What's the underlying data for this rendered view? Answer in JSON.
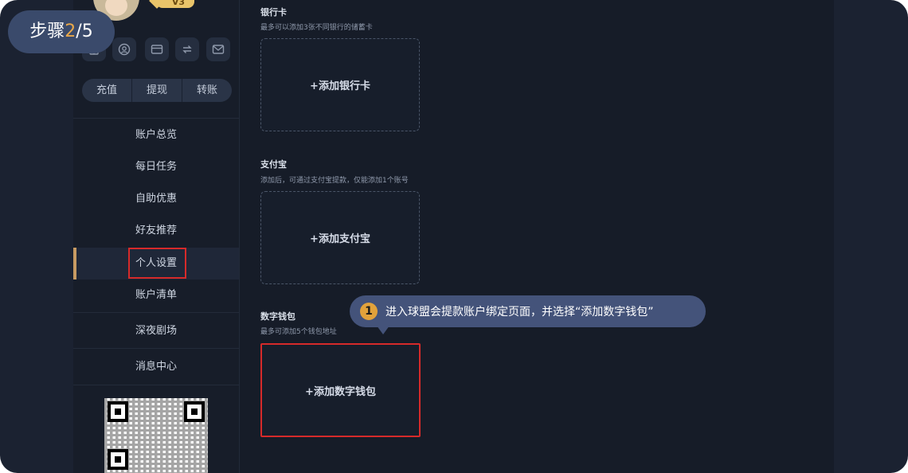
{
  "step": {
    "label": "步骤",
    "current": "2",
    "separator": "/",
    "total": "5"
  },
  "profile": {
    "vip_level": "V3"
  },
  "quick_actions": [
    "充值",
    "提现",
    "转账"
  ],
  "menu": [
    {
      "label": "账户总览"
    },
    {
      "label": "每日任务"
    },
    {
      "label": "自助优惠"
    },
    {
      "label": "好友推荐"
    },
    {
      "label": "个人设置"
    },
    {
      "label": "账户清单"
    },
    {
      "label": "深夜剧场"
    },
    {
      "label": "消息中心"
    }
  ],
  "active_menu": "个人设置",
  "sections": {
    "bank": {
      "title": "银行卡",
      "subtitle": "最多可以添加3张不同银行的储蓄卡",
      "button": "+添加银行卡"
    },
    "alipay": {
      "title": "支付宝",
      "subtitle": "添加后，可通过支付宝提款，仅能添加1个账号",
      "button": "+添加支付宝"
    },
    "wallet": {
      "title": "数字钱包",
      "subtitle": "最多可添加5个钱包地址",
      "button": "+添加数字钱包"
    }
  },
  "tooltip": {
    "number": "1",
    "text": "进入球盟会提款账户绑定页面，并选择“添加数字钱包”"
  },
  "colors": {
    "accent": "#e9a84a",
    "highlight": "#d62a2a",
    "background": "#1b2231",
    "tooltip": "#44537a"
  }
}
